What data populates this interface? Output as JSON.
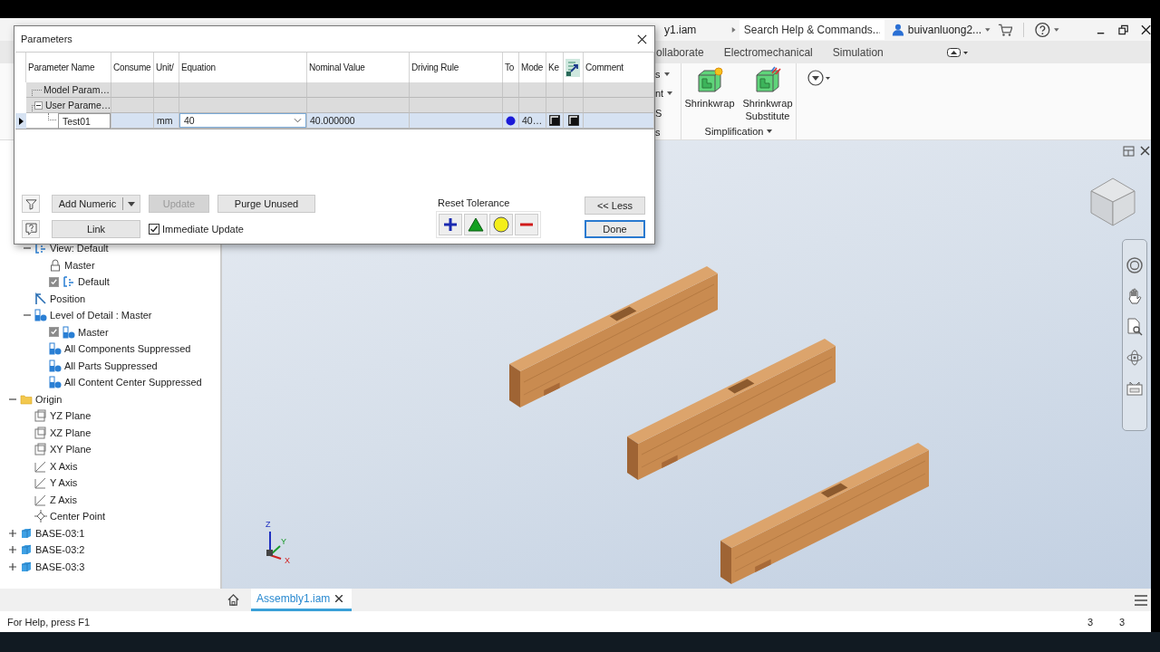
{
  "title_bar": {
    "document": "y1.iam",
    "search": {
      "placeholder": "Search Help & Commands..."
    },
    "user": "buivanluong2..."
  },
  "ribbon_tabs": [
    {
      "label": "ollaborate",
      "selected": false
    },
    {
      "label": "Electromechanical",
      "selected": false
    },
    {
      "label": "Simulation",
      "selected": false
    }
  ],
  "ribbon": {
    "cut_items": [
      {
        "text": "s",
        "caret": true
      },
      {
        "text": "nt",
        "caret": true
      },
      {
        "text": "S",
        "caret": false
      },
      {
        "text": "s",
        "caret": false
      }
    ],
    "buttons": [
      {
        "label": "Shrinkwrap",
        "kind": "shrinkwrap"
      },
      {
        "label": "Shrinkwrap Substitute",
        "kind": "substitute"
      }
    ],
    "panel_label": "Simplification"
  },
  "browser": {
    "partial_branch": [
      {
        "label": "View: Default",
        "kind": "view",
        "expanded": true,
        "children": [
          {
            "label": "Master",
            "kind": "lock"
          },
          {
            "label": "Default",
            "kind": "view",
            "checked": true
          }
        ]
      },
      {
        "label": "Position",
        "kind": "position"
      },
      {
        "label": "Level of Detail : Master",
        "kind": "lod",
        "expanded": true,
        "children": [
          {
            "label": "Master",
            "kind": "lod",
            "checked": true
          },
          {
            "label": "All Components Suppressed",
            "kind": "lod"
          },
          {
            "label": "All Parts Suppressed",
            "kind": "lod"
          },
          {
            "label": "All Content Center Suppressed",
            "kind": "lod"
          }
        ]
      }
    ],
    "items": [
      {
        "label": "Origin",
        "kind": "folder",
        "expanded": true,
        "children": [
          {
            "label": "YZ Plane",
            "kind": "plane"
          },
          {
            "label": "XZ Plane",
            "kind": "plane"
          },
          {
            "label": "XY Plane",
            "kind": "plane"
          },
          {
            "label": "X Axis",
            "kind": "axis"
          },
          {
            "label": "Y Axis",
            "kind": "axis"
          },
          {
            "label": "Z Axis",
            "kind": "axis"
          },
          {
            "label": "Center Point",
            "kind": "point"
          }
        ]
      },
      {
        "label": "BASE-03:1",
        "kind": "part",
        "expanded": false
      },
      {
        "label": "BASE-03:2",
        "kind": "part",
        "expanded": false
      },
      {
        "label": "BASE-03:3",
        "kind": "part",
        "expanded": false
      }
    ]
  },
  "viewport": {
    "axis_labels": [
      "Z",
      "Y",
      "X"
    ]
  },
  "dialog": {
    "title": "Parameters",
    "columns": [
      {
        "kind": "text",
        "label": "Parameter Name"
      },
      {
        "kind": "text",
        "label": "Consume"
      },
      {
        "kind": "text",
        "label": "Unit/"
      },
      {
        "kind": "text",
        "label": "Equation"
      },
      {
        "kind": "text",
        "label": "Nominal Value"
      },
      {
        "kind": "text",
        "label": "Driving Rule"
      },
      {
        "kind": "text",
        "label": "To"
      },
      {
        "kind": "text",
        "label": "Mode"
      },
      {
        "kind": "text",
        "label": "Ke"
      },
      {
        "kind": "icon"
      },
      {
        "kind": "text",
        "label": "Comment"
      }
    ],
    "groups": [
      {
        "label": "Model Param…"
      },
      {
        "label": "User Parame…",
        "expanded": true,
        "rows": [
          {
            "name": "Test01",
            "unit": "mm",
            "equation": "40",
            "nominal_value": "40.000000",
            "model_value": "40…",
            "key": true,
            "export": true,
            "selected": true
          }
        ]
      }
    ],
    "add_numeric": "Add Numeric",
    "update": {
      "label": "Update",
      "disabled": true
    },
    "purge": "Purge Unused",
    "link": "Link",
    "immediate_update": {
      "label": "Immediate Update",
      "checked": true
    },
    "reset_tolerance": {
      "label": "Reset Tolerance",
      "buttons": [
        {
          "kind": "upper"
        },
        {
          "kind": "median"
        },
        {
          "kind": "nominal"
        },
        {
          "kind": "lower"
        }
      ]
    },
    "less": "<< Less",
    "done": "Done"
  },
  "doc_tabs": [
    {
      "label": "Assembly1.iam",
      "selected": true
    }
  ],
  "status_bar": {
    "text": "For Help, press F1",
    "counts": [
      "3",
      "3"
    ]
  }
}
